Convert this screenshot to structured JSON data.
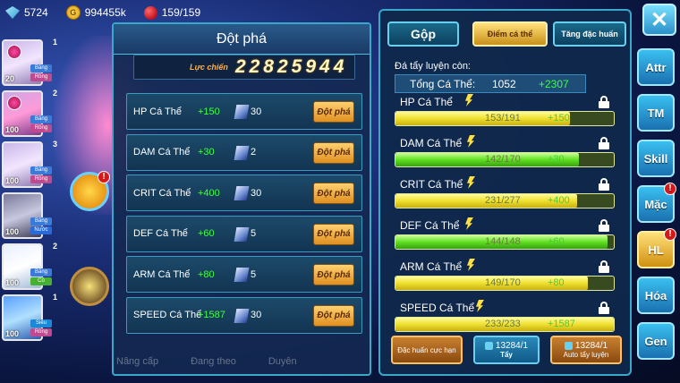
{
  "topbar": {
    "gems": "5724",
    "coins": "994455k",
    "coin_symbol": "G",
    "stamina": "159/159"
  },
  "pets": [
    {
      "level": "20",
      "tag1": "Băng",
      "tag2": "Rồng",
      "count": "1"
    },
    {
      "level": "100",
      "tag1": "Băng",
      "tag2": "Rồng",
      "count": ""
    },
    {
      "level": "100",
      "tag1": "Băng",
      "tag2": "Rồng",
      "count": "3"
    },
    {
      "level": "100",
      "tag1": "Băng",
      "tag2": "Nước",
      "count": ""
    },
    {
      "level": "100",
      "tag1": "Băng",
      "tag2": "Cỏ",
      "count": "2"
    },
    {
      "level": "100",
      "tag1": "Siêu",
      "tag2": "Rồng",
      "count": "1"
    }
  ],
  "pet_top_counts": [
    "1",
    "2"
  ],
  "breakthrough": {
    "title": "Đột phá",
    "power_label": "Lực chiến",
    "power_value": "22825944",
    "button_label": "Đột phá",
    "rows": [
      {
        "name": "HP Cá Thể",
        "plus": "+150",
        "cost": "30"
      },
      {
        "name": "DAM Cá Thể",
        "plus": "+30",
        "cost": "2"
      },
      {
        "name": "CRIT Cá Thể",
        "plus": "+400",
        "cost": "30"
      },
      {
        "name": "DEF Cá Thể",
        "plus": "+60",
        "cost": "5"
      },
      {
        "name": "ARM Cá Thể",
        "plus": "+80",
        "cost": "5"
      },
      {
        "name": "SPEED Cá Thể",
        "plus": "+1587",
        "cost": "30"
      }
    ]
  },
  "under_labels": [
    "Nâng cấp",
    "Đang theo",
    "Duyên"
  ],
  "right": {
    "tabs": [
      "Gộp",
      "Điểm cá thể",
      "Tăng đặc huấn"
    ],
    "remaining_label": "Đá tẩy luyện còn:",
    "total": {
      "label": "Tổng Cá Thể:",
      "value": "1052",
      "plus": "+2307"
    },
    "stats": [
      {
        "name": "HP Cá Thể",
        "value": "153/191",
        "plus": "+150",
        "fill": 0.8,
        "color": "yellow"
      },
      {
        "name": "DAM Cá Thể",
        "value": "142/170",
        "plus": "+30",
        "fill": 0.84,
        "color": "green"
      },
      {
        "name": "CRIT Cá Thể",
        "value": "231/277",
        "plus": "+400",
        "fill": 0.83,
        "color": "yellow"
      },
      {
        "name": "DEF Cá Thể",
        "value": "144/148",
        "plus": "+60",
        "fill": 0.97,
        "color": "green"
      },
      {
        "name": "ARM Cá Thể",
        "value": "149/170",
        "plus": "+80",
        "fill": 0.88,
        "color": "yellow"
      },
      {
        "name": "SPEED Cá Thể",
        "value": "233/233",
        "plus": "+1587",
        "fill": 1.0,
        "color": "yellow"
      }
    ],
    "buttons": {
      "b1": "Đặc huấn cực hạn",
      "b2_count": "13284/1",
      "b2_label": "Tẩy",
      "b3_count": "13284/1",
      "b3_label": "Auto tẩy luyện"
    }
  },
  "close_symbol": "✕",
  "side_menu": [
    {
      "label": "Attr",
      "active": false,
      "alert": false
    },
    {
      "label": "TM",
      "active": false,
      "alert": false
    },
    {
      "label": "Skill",
      "active": false,
      "alert": false
    },
    {
      "label": "Mặc",
      "active": false,
      "alert": true
    },
    {
      "label": "HL",
      "active": true,
      "alert": true
    },
    {
      "label": "Hóa",
      "active": false,
      "alert": false
    },
    {
      "label": "Gen",
      "active": false,
      "alert": false
    }
  ],
  "alert_symbol": "!"
}
